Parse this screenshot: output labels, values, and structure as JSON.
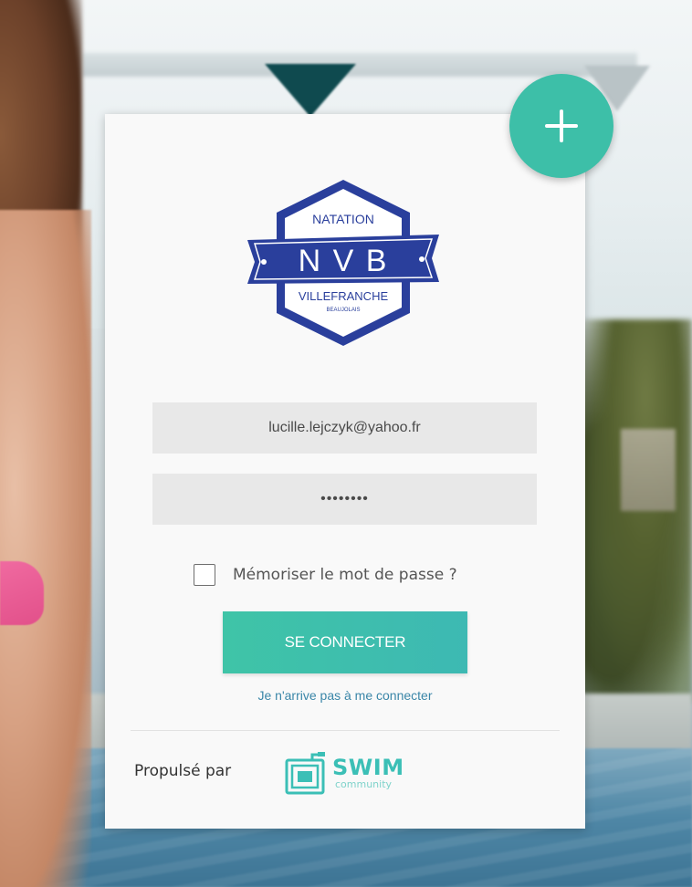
{
  "login": {
    "email_value": "lucille.lejczyk@yahoo.fr",
    "password_value": "••••••••",
    "remember_label": "Mémoriser le mot de passe ?",
    "connect_label": "SE CONNECTER",
    "forgot_label": "Je n'arrive pas à me connecter",
    "remember_checked": false
  },
  "club_logo": {
    "top_text": "NATATION",
    "main_text": "N V B",
    "bottom_text": "VILLEFRANCHE",
    "bottom_sub_text": "BEAUJOLAIS"
  },
  "footer": {
    "powered_by": "Propulsé par",
    "brand_word": "SWIM",
    "brand_sub": "community"
  },
  "fab": {
    "icon": "plus-icon"
  },
  "colors": {
    "accent": "#3dbfa8",
    "link": "#3a86a8",
    "club_blue": "#2a3f9c"
  }
}
